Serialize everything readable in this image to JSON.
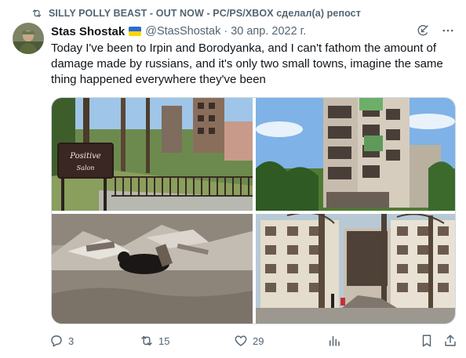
{
  "repost": {
    "text": "SILLY POLLY BEAST - OUT NOW - PC/PS/XBOX сделал(а) репост",
    "icon": "repost-icon"
  },
  "tweet": {
    "author": {
      "display_name": "Stas Shostak",
      "flag_icon": "ukraine-flag-icon",
      "handle": "@StasShostak",
      "separator": "·",
      "date": "30 апр. 2022 г."
    },
    "text": "Today I've been to Irpin and Borodyanka, and I can't fathom the amount of damage made by russians, and it's only two small towns, imagine the same thing happened everywhere they've been",
    "media": {
      "sign_line1": "Positive",
      "sign_line2": "Salon"
    },
    "stats": {
      "replies": "3",
      "reposts": "15",
      "likes": "29"
    }
  },
  "colors": {
    "text": "#0f1419",
    "secondary": "#536471",
    "border": "#cfd9de"
  }
}
